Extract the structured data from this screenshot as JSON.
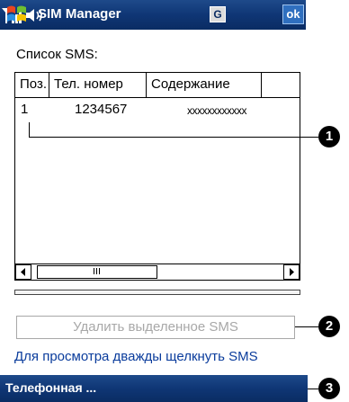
{
  "titlebar": {
    "title": "SIM Manager",
    "g_label": "G",
    "ok_label": "ok"
  },
  "main": {
    "list_label": "Список SMS:",
    "columns": [
      "Поз.",
      "Тел. номер",
      "Содержание"
    ],
    "rows": [
      {
        "pos": "1",
        "phone": "1234567",
        "content": "xxxxxxxxxxxx"
      }
    ],
    "delete_button": "Удалить выделенное SMS",
    "hint": "Для просмотра дважды щелкнуть SMS"
  },
  "menubar": {
    "left_menu": "Телефонная ..."
  },
  "callouts": [
    "1",
    "2",
    "3"
  ],
  "colors": {
    "titlebar": "#0f3675",
    "hint_link": "#0a3c9c",
    "disabled_text": "#a8a8a8"
  }
}
